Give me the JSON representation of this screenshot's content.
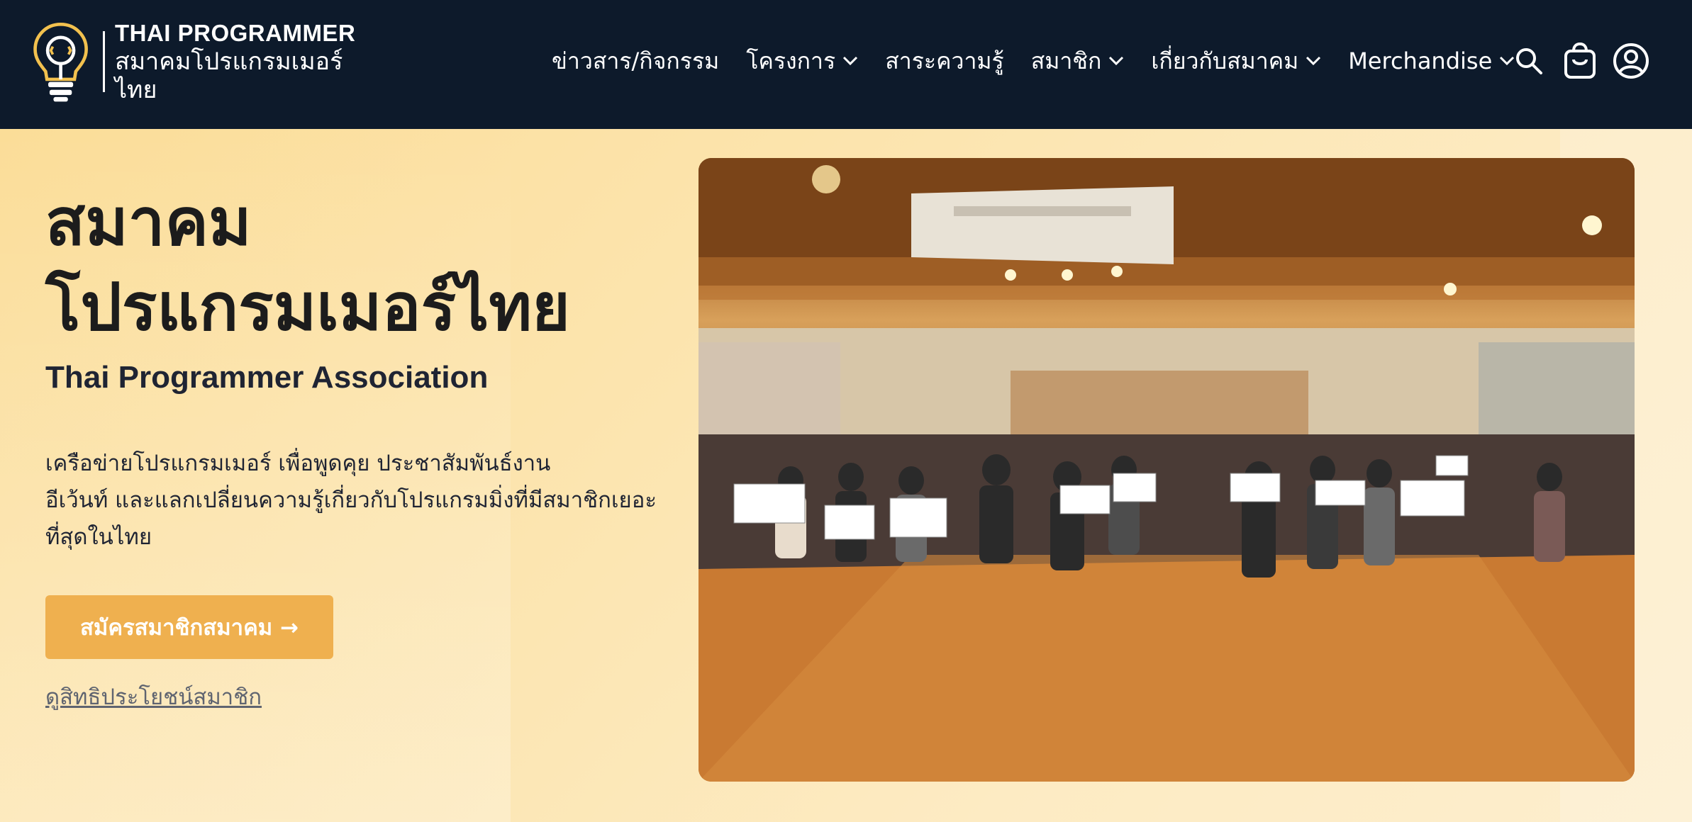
{
  "header": {
    "logo": {
      "name_en": "THAI PROGRAMMER",
      "name_th": "สมาคมโปรแกรมเมอร์ไทย"
    },
    "nav": [
      {
        "label": "ข่าวสาร/กิจกรรม",
        "has_dropdown": false
      },
      {
        "label": "โครงการ",
        "has_dropdown": true
      },
      {
        "label": "สาระความรู้",
        "has_dropdown": false
      },
      {
        "label": "สมาชิก",
        "has_dropdown": true
      },
      {
        "label": "เกี่ยวกับสมาคม",
        "has_dropdown": true
      },
      {
        "label": "Merchandise",
        "has_dropdown": true
      }
    ],
    "icons": [
      "search-icon",
      "shopping-bag-icon",
      "user-icon"
    ]
  },
  "hero": {
    "title_line1": "สมาคม",
    "title_line2": "โปรแกรมเมอร์ไทย",
    "subtitle": "Thai Programmer Association",
    "desc_line1": "เครือข่ายโปรแกรมเมอร์ เพื่อพูดคุย ประชาสัมพันธ์งาน",
    "desc_line2": "อีเว้นท์ และแลกเปลี่ยนความรู้เกี่ยวกับโปรแกรมมิ่งที่มีสมาชิกเยอะ",
    "desc_line3": "ที่สุดในไทย",
    "cta_label": "สมัครสมาชิกสมาคม →",
    "link_label": "ดูสิทธิประโยชน์สมาชิก"
  },
  "colors": {
    "header_bg": "#0d1a2b",
    "accent": "#efb04f",
    "hero_bg": "#fbe7b8",
    "text_dark": "#1c1c1c"
  }
}
